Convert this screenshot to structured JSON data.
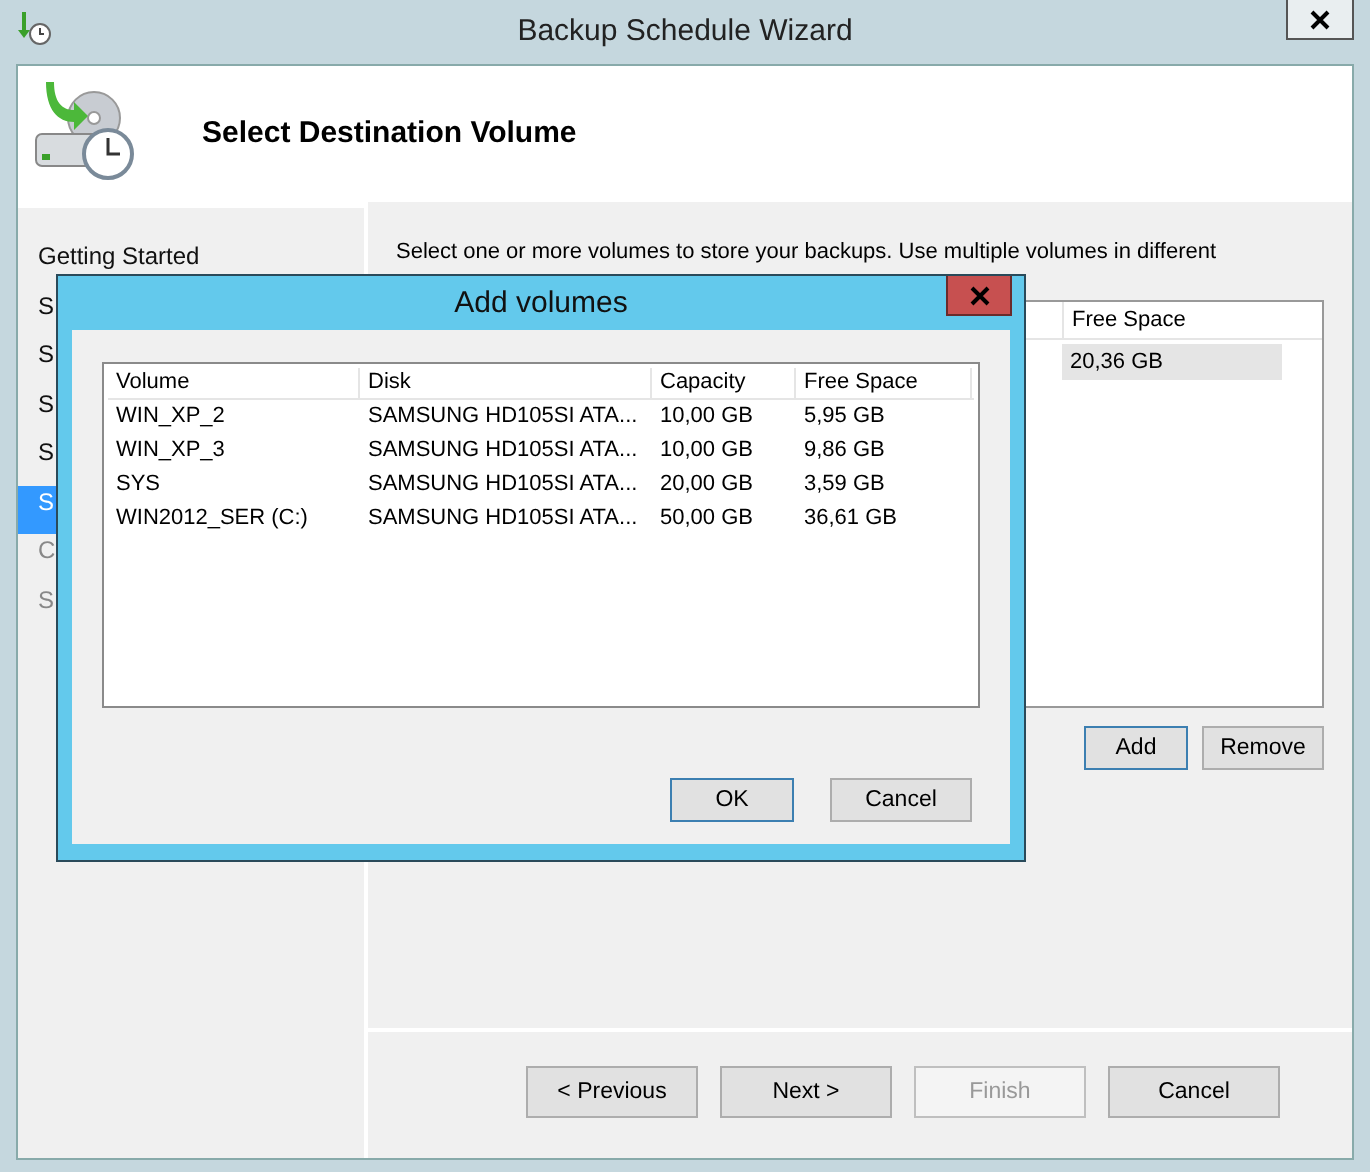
{
  "window": {
    "title": "Backup Schedule Wizard"
  },
  "header": {
    "title": "Select Destination Volume"
  },
  "steps": [
    {
      "label": "Getting Started",
      "selected": false
    },
    {
      "label": "S",
      "selected": false
    },
    {
      "label": "S",
      "selected": false
    },
    {
      "label": "S",
      "selected": false
    },
    {
      "label": "S",
      "selected": false
    },
    {
      "label": "S",
      "selected": true
    },
    {
      "label": "C",
      "selected": false
    },
    {
      "label": "S",
      "selected": false
    }
  ],
  "description": "Select one or more volumes to store your backups. Use multiple volumes in different",
  "destination_list": {
    "columns": [
      "Free Space"
    ],
    "rows": [
      {
        "cells": [
          "20,36 GB"
        ],
        "selected": true
      }
    ]
  },
  "list_buttons": [
    {
      "label": "Add",
      "default": true
    },
    {
      "label": "Remove",
      "default": false
    }
  ],
  "nav_buttons": [
    {
      "label": "< Previous",
      "disabled": false
    },
    {
      "label": "Next >",
      "disabled": false
    },
    {
      "label": "Finish",
      "disabled": true
    },
    {
      "label": "Cancel",
      "disabled": false
    }
  ],
  "dialog": {
    "title": "Add volumes",
    "columns": [
      "Volume",
      "Disk",
      "Capacity",
      "Free Space"
    ],
    "rows": [
      [
        "WIN_XP_2",
        "SAMSUNG HD105SI ATA...",
        "10,00 GB",
        "5,95 GB"
      ],
      [
        "WIN_XP_3",
        "SAMSUNG HD105SI ATA...",
        "10,00 GB",
        "9,86 GB"
      ],
      [
        "SYS",
        "SAMSUNG HD105SI ATA...",
        "20,00 GB",
        "3,59 GB"
      ],
      [
        "WIN2012_SER (C:)",
        "SAMSUNG HD105SI ATA...",
        "50,00 GB",
        "36,61 GB"
      ]
    ],
    "buttons": [
      {
        "label": "OK",
        "default": true
      },
      {
        "label": "Cancel",
        "default": false
      }
    ]
  }
}
